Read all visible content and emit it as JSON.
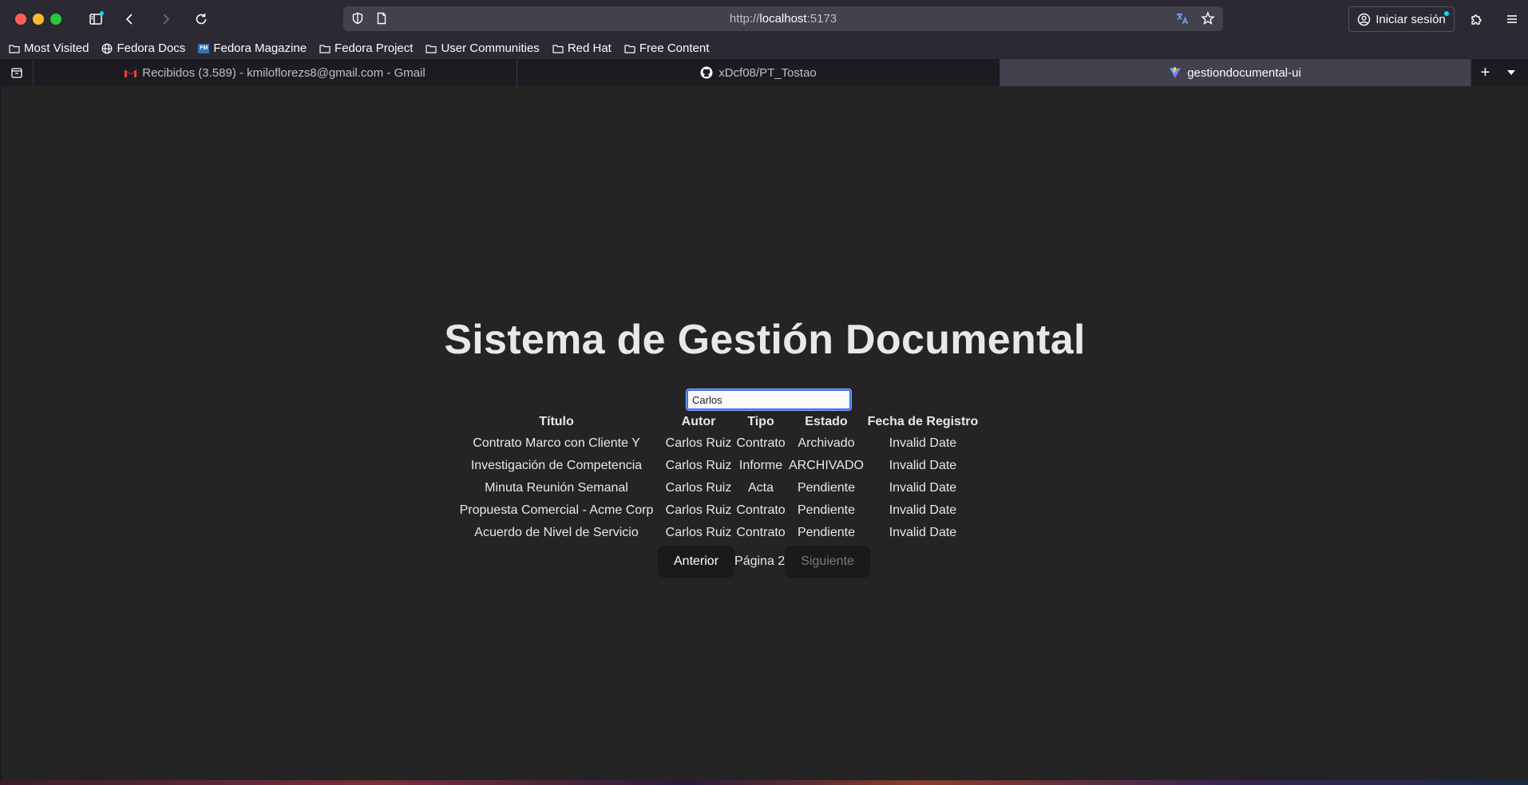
{
  "browser": {
    "url_scheme": "http://",
    "url_host": "localhost",
    "url_port": ":5173",
    "signin_label": "Iniciar sesión",
    "bookmarks": [
      {
        "label": "Most Visited",
        "icon": "folder-icon"
      },
      {
        "label": "Fedora Docs",
        "icon": "globe-icon"
      },
      {
        "label": "Fedora Magazine",
        "icon": "fedora-magazine-icon"
      },
      {
        "label": "Fedora Project",
        "icon": "folder-icon"
      },
      {
        "label": "User Communities",
        "icon": "folder-icon"
      },
      {
        "label": "Red Hat",
        "icon": "folder-icon"
      },
      {
        "label": "Free Content",
        "icon": "folder-icon"
      }
    ],
    "tabs": [
      {
        "label": "Recibidos (3.589) - kmiloflorezs8@gmail.com - Gmail",
        "icon": "gmail-icon",
        "active": false
      },
      {
        "label": "xDcf08/PT_Tostao",
        "icon": "github-icon",
        "active": false
      },
      {
        "label": "gestiondocumental-ui",
        "icon": "vite-icon",
        "active": true
      }
    ]
  },
  "app": {
    "title": "Sistema de Gestión Documental",
    "search": {
      "value": "Carlos"
    },
    "table": {
      "headers": [
        "Título",
        "Autor",
        "Tipo",
        "Estado",
        "Fecha de Registro"
      ],
      "rows": [
        [
          "Contrato Marco con Cliente Y",
          "Carlos Ruiz",
          "Contrato",
          "Archivado",
          "Invalid Date"
        ],
        [
          "Investigación de Competencia",
          "Carlos Ruiz",
          "Informe",
          "ARCHIVADO",
          "Invalid Date"
        ],
        [
          "Minuta Reunión Semanal",
          "Carlos Ruiz",
          "Acta",
          "Pendiente",
          "Invalid Date"
        ],
        [
          "Propuesta Comercial - Acme Corp",
          "Carlos Ruiz",
          "Contrato",
          "Pendiente",
          "Invalid Date"
        ],
        [
          "Acuerdo de Nivel de Servicio",
          "Carlos Ruiz",
          "Contrato",
          "Pendiente",
          "Invalid Date"
        ]
      ]
    },
    "pagination": {
      "prev_label": "Anterior",
      "page_label": "Página 2",
      "next_label": "Siguiente"
    }
  }
}
